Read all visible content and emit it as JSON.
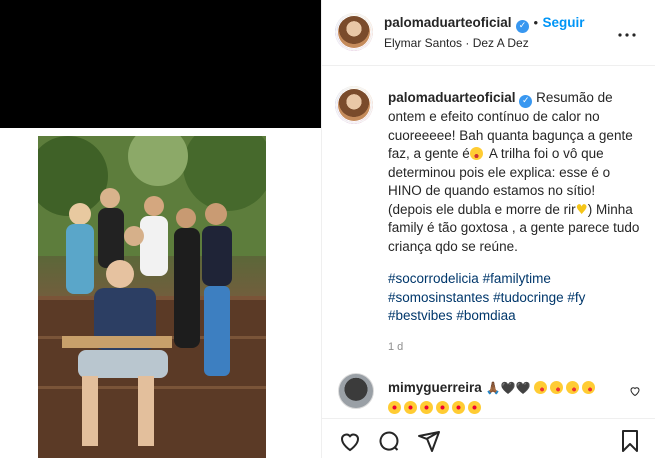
{
  "post": {
    "username": "palomaduarteoficial",
    "follow_label": "Seguir",
    "separator": "•",
    "audio": "Elymar Santos · Dez A Dez",
    "more_icon": "more-horizontal-icon"
  },
  "caption": {
    "username": "palomaduarteoficial",
    "text_part1": "Resumão de ontem e efeito contínuo de calor no cuoreeeee! Bah quanta bagunça a gente faz, a gente é",
    "text_part2": " A trilha foi o vô que determinou pois ele explica: esse é o HINO de quando estamos no sítio! (depois ele dubla e morre de rir",
    "text_part3": ") Minha family é tão goxtosa , a gente parece tudo criança qdo se reúne.",
    "emoji1": "laughing-emoji",
    "emoji2": "yellow-heart-emoji"
  },
  "hashtags": [
    "#socorrodelicia",
    "#familytime",
    "#somosinstantes",
    "#tudocringe",
    "#fy",
    "#bestvibes",
    "#bomdiaa"
  ],
  "timestamp": "1 d",
  "comment": {
    "username": "mimyguerreira",
    "glyphs_line1": "🙏🏾🖤🖤",
    "emoji_line1": [
      "kiss",
      "kiss",
      "kiss",
      "kiss"
    ],
    "emoji_line2": [
      "star",
      "star",
      "star",
      "star",
      "star",
      "star"
    ]
  },
  "colors": {
    "link": "#0095f6",
    "hashtag": "#00376b",
    "verified": "#3897f0",
    "muted": "#8e8e8e"
  }
}
